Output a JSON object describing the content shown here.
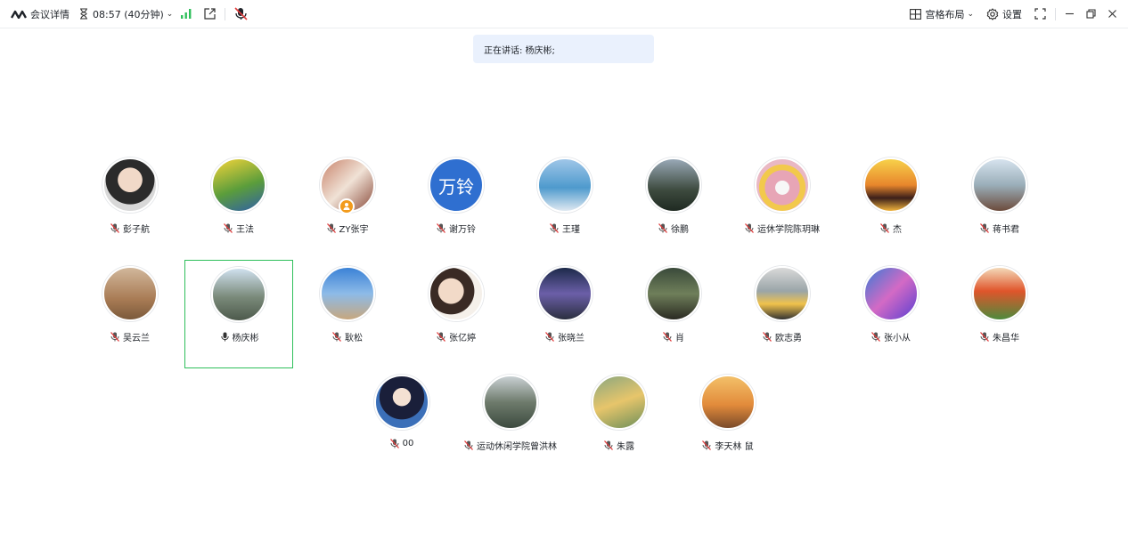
{
  "topbar": {
    "meeting_details": "会议详情",
    "timer": "08:57 (40分钟)",
    "layout": "宫格布局",
    "settings": "设置"
  },
  "speaking": {
    "text": "正在讲话: 杨庆彬;"
  },
  "participants": [
    {
      "name": "彭子航"
    },
    {
      "name": "王法"
    },
    {
      "name": "ZY张宇"
    },
    {
      "name": "谢万铃",
      "avatar_text": "万铃"
    },
    {
      "name": "王瑾"
    },
    {
      "name": "徐鹏"
    },
    {
      "name": "运休学院陈玥琳"
    },
    {
      "name": "杰"
    },
    {
      "name": "蒋书君"
    },
    {
      "name": "吴云兰"
    },
    {
      "name": "杨庆彬"
    },
    {
      "name": "耿松"
    },
    {
      "name": "张亿婷"
    },
    {
      "name": "张晓兰"
    },
    {
      "name": "肖"
    },
    {
      "name": "欧志勇"
    },
    {
      "name": "张小从"
    },
    {
      "name": "朱昌华"
    },
    {
      "name": "00"
    },
    {
      "name": "运动休闲学院曾洪林"
    },
    {
      "name": "朱露"
    },
    {
      "name": "李天林 鼠"
    }
  ],
  "colors": {
    "accent_blue": "#2f6fd0",
    "active_border": "#2fbf5b",
    "signal_green": "#2fbf5b",
    "toast_bg": "#eaf1fd"
  }
}
